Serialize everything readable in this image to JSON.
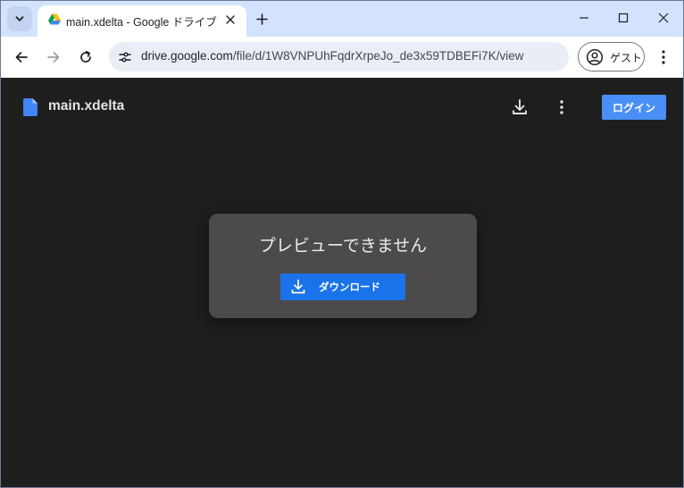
{
  "browser": {
    "tab": {
      "title": "main.xdelta - Google ドライブ",
      "favicon": "google-drive-icon"
    },
    "omnibox": {
      "url_host": "drive.google.com",
      "url_path": "/file/d/1W8VNPUhFqdrXrpeJo_de3x59TDBEFi7K/view"
    },
    "profile": {
      "label": "ゲスト"
    }
  },
  "viewer": {
    "file_name": "main.xdelta",
    "login_label": "ログイン",
    "no_preview_message": "プレビューできません",
    "download_label": "ダウンロード"
  },
  "colors": {
    "tabstrip": "#d3e3fd",
    "viewer_background": "#1e1e1e",
    "card_background": "#4c4a4b",
    "primary_button": "#1a73e8",
    "login_button": "#4a8ff5"
  }
}
